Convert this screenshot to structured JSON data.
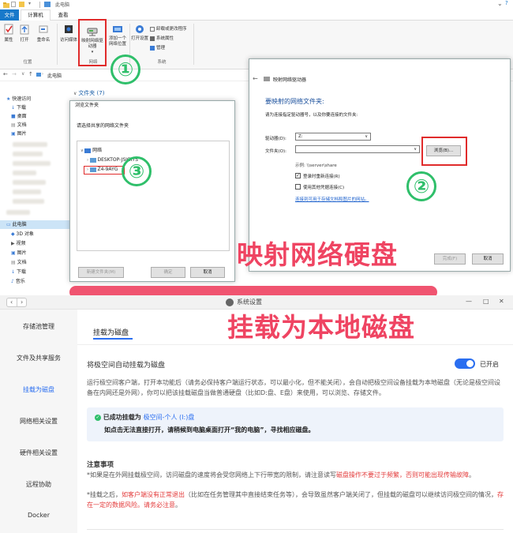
{
  "explorer": {
    "window_title": "此电脑",
    "tabs": {
      "file": "文件",
      "computer": "计算机",
      "view": "查看"
    },
    "ribbon": {
      "properties": "属性",
      "open": "打开",
      "rename": "重命名",
      "location_group": "位置",
      "access_media": "访问媒体",
      "map_drive": "映射网络驱动器",
      "add_location": "添加一个网络位置",
      "network_group": "网络",
      "open_settings": "打开设置",
      "uninstall": "卸载或更改程序",
      "system_props": "系统属性",
      "manage": "管理",
      "system_group": "系统"
    },
    "address_path": "此电脑",
    "folders_header": "文件夹 (7)",
    "nav": {
      "quick_access": "快速访问",
      "downloads": "下载",
      "desktop": "桌面",
      "documents": "文档",
      "pictures": "图片",
      "this_pc": "此电脑",
      "objects3d": "3D 对象",
      "videos": "视频",
      "pictures2": "图片",
      "documents2": "文档",
      "downloads2": "下载",
      "music": "音乐"
    }
  },
  "browse_dialog": {
    "title": "浏览文件夹",
    "prompt": "请选择共享的网络文件夹",
    "tree_root": "网络",
    "tree_item_1": "DESKTOP-JSJGI7S",
    "tree_item_2": "Z4-9AYG",
    "new_folder": "新建文件夹(M)",
    "ok": "确定",
    "cancel": "取消"
  },
  "map_dialog": {
    "title": "映射网络驱动器",
    "heading": "要映射的网络文件夹:",
    "subheading": "请为连接指定驱动器号，以及你要连接的文件夹:",
    "drive_label": "驱动器(D):",
    "drive_value": "Z:",
    "folder_label": "文件夹(O):",
    "folder_value": "",
    "browse": "浏览(B)...",
    "example": "示例: \\\\server\\share",
    "reconnect": "登录时重新连接(R)",
    "other_creds": "使用其他凭据连接(C)",
    "link": "连接到可用于存储文档和图片的网站。",
    "finish": "完成(F)",
    "cancel": "取消"
  },
  "markers": {
    "one": "①",
    "two": "②",
    "three": "③"
  },
  "banner_top": "映射网络硬盘",
  "banner_bottom": "挂载为本地磁盘",
  "settings": {
    "title": "系统设置",
    "sidebar": [
      "存储池管理",
      "文件及共享服务",
      "挂载为磁盘",
      "网络相关设置",
      "硬件相关设置",
      "远程协助",
      "Docker"
    ],
    "active_index": 2,
    "tab": "挂载为磁盘",
    "auto_mount_label": "将极空间自动挂载为磁盘",
    "toggle_state": "已开启",
    "desc": "运行极空间客户端，打开本功能后（请务必保持客户端运行状态，可以最小化，但不能关闭），会自动把极空间设备挂载为本地磁盘（无论是极空间设备在内网还是外网），你可以把该挂载磁盘当做普通硬盘（比如D:盘、E盘）来使用，可以浏览、存储文件。",
    "success_prefix": "已成功挂载为",
    "success_drive": "极空间-个人 (I:)盘",
    "success_hint": "如点击无法直接打开，请稍候到电脑桌面打开“我的电脑”，寻找相应磁盘。",
    "note_title": "注意事项",
    "note1_a": "*如果是在外网挂载极空间，访问磁盘的速度将会受您网络上下行带宽的限制，请注意读写",
    "note1_red": "磁盘操作不要过于频繁，否则可能出现传输故障",
    "note1_end": "。",
    "note2_a": "*挂载之后，",
    "note2_red1": "如客户端没有正常退出",
    "note2_b": "（比如在任务管理其中直接结束任务等），会导致虽然客户端关闭了，但挂载的磁盘可以继续访问极空间的情况，",
    "note2_red2": "存在一定的数据风险。请务必注意",
    "note2_end": "。"
  }
}
